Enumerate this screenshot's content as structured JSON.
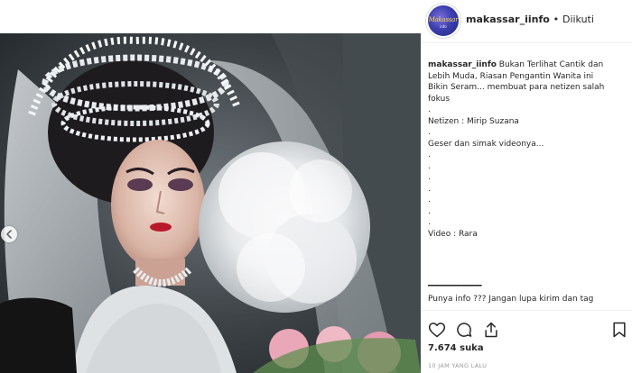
{
  "post": {
    "username": "makassar_iinfo",
    "follow_separator": "•",
    "follow_status": "Diikuti",
    "avatar_text": "Makassar",
    "avatar_subtext": "info",
    "caption_lines": [
      {
        "text": "Bukan Terlihat Cantik dan",
        "lead": true
      },
      {
        "text": "Lebih Muda, Riasan Pengantin Wanita ini"
      },
      {
        "text": "Bikin Seram... membuat para netizen salah"
      },
      {
        "text": "fokus"
      },
      {
        "text": "."
      },
      {
        "text": "Netizen : Mirip Suzana"
      },
      {
        "text": "."
      },
      {
        "text": "Geser dan simak videonya..."
      },
      {
        "text": "."
      },
      {
        "text": "."
      },
      {
        "text": "."
      },
      {
        "text": "."
      },
      {
        "text": "."
      },
      {
        "text": "."
      },
      {
        "text": "."
      },
      {
        "text": "Video : Rara"
      }
    ],
    "divider": "━━━━━━━━━━━━",
    "more_text": "Punya info ??? Jangan lupa kirim dan tag",
    "likes": "7.674 suka",
    "time_ago": "10 JAM YANG LALU"
  },
  "icons": {
    "like": "heart-outline-icon",
    "comment": "comment-bubble-icon",
    "share": "share-arrow-icon",
    "save": "bookmark-icon",
    "carousel": "chevron-left-icon"
  },
  "colors": {
    "text": "#262626",
    "muted": "#999999",
    "border": "#efefef"
  }
}
